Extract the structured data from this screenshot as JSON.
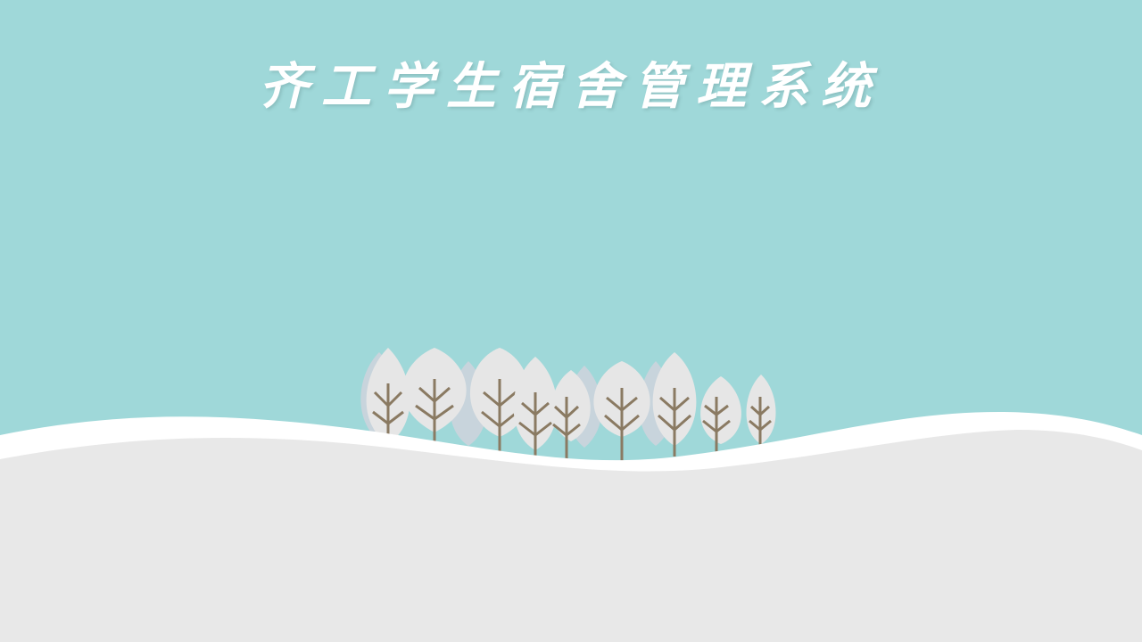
{
  "title": "齐工学生宿舍管理系统",
  "colors": {
    "sky": "#9fd8d9",
    "snow_band": "#ffffff",
    "ground": "#e8e8e8",
    "tree_leaf": "#e6e6e6",
    "tree_leaf_shadow": "#c8d4dc",
    "trunk": "#8a7a62"
  },
  "scene": {
    "decorations": [
      "tree-icon",
      "snow-hill"
    ]
  }
}
